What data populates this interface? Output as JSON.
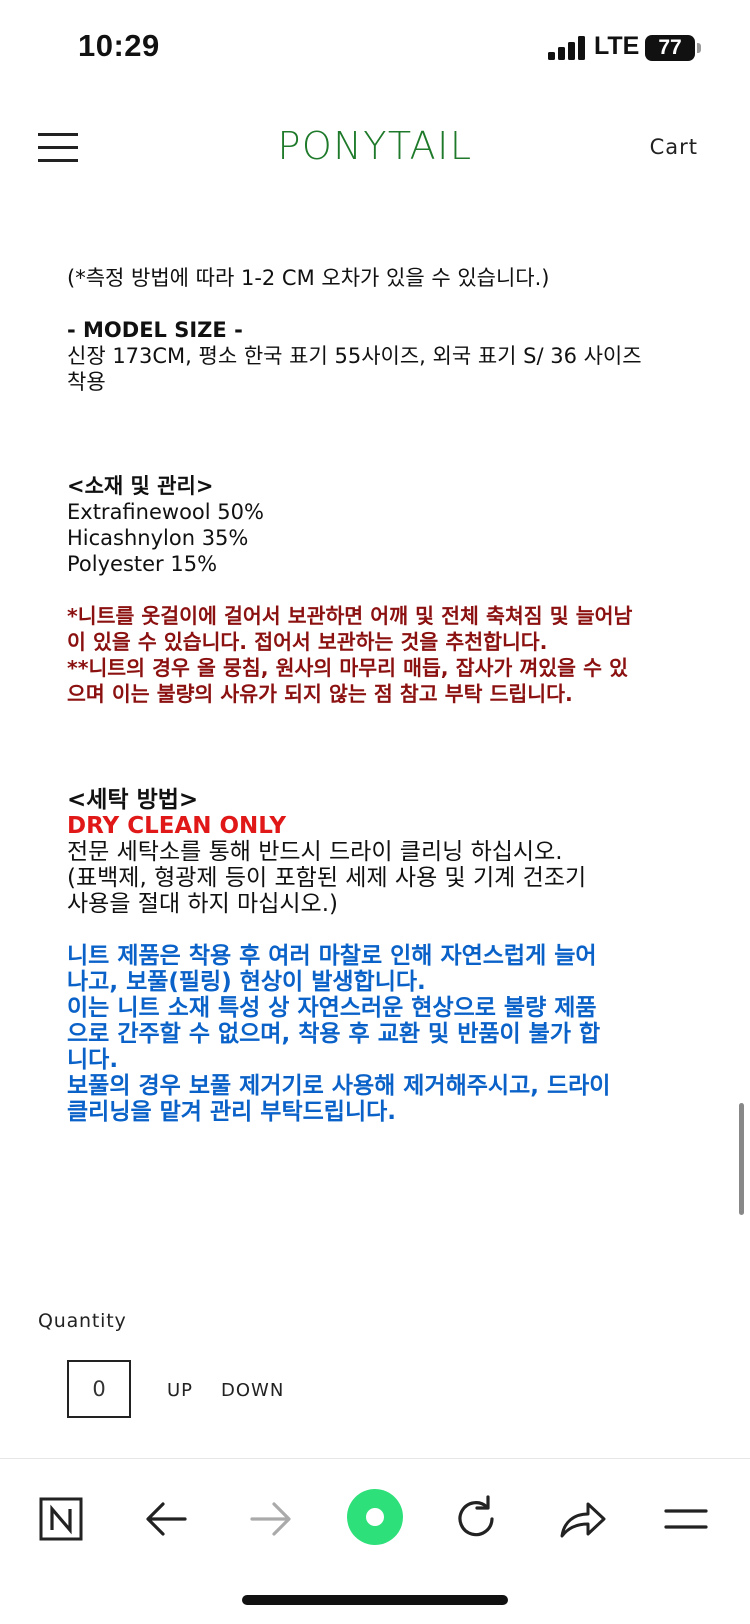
{
  "status": {
    "time": "10:29",
    "network": "LTE",
    "battery": "77"
  },
  "header": {
    "brand": "PONYTAIL",
    "cart": "Cart"
  },
  "content": {
    "measure_note": "(*측정 방법에 따라 1-2 CM 오차가 있을 수 있습니다.)",
    "model_title": "- MODEL SIZE -",
    "model_line1": "신장 173CM, 평소 한국 표기 55사이즈, 외국 표기 S/ 36 사이즈",
    "model_line2": "착용",
    "material_title": "<소재 및 관리>",
    "material1": "Extrafinewool 50%",
    "material2": "Hicashnylon 35%",
    "material3": "Polyester 15%",
    "care_red1": "*니트를 옷걸이에 걸어서 보관하면 어깨 및 전체 축쳐짐 및 늘어남",
    "care_red2": "이 있을 수 있습니다. 접어서 보관하는 것을 추천합니다.",
    "care_red3": "**니트의 경우 올 뭉침, 원사의 마무리 매듭, 잡사가 껴있을 수 있",
    "care_red4": "으며 이는 불량의 사유가 되지 않는 점 참고 부탁 드립니다.",
    "wash_title": "<세탁 방법>",
    "dry_clean": "DRY CLEAN ONLY",
    "wash1": "전문 세탁소를 통해 반드시 드라이 클리닝 하십시오.",
    "wash2": "(표백제, 형광제 등이 포함된 세제 사용 및 기계 건조기",
    "wash3": "사용을 절대 하지 마십시오.)",
    "blue1": "니트 제품은 착용 후 여러 마찰로 인해 자연스럽게 늘어",
    "blue2": "나고, 보풀(필링) 현상이 발생합니다.",
    "blue3": "이는 니트 소재 특성 상 자연스러운 현상으로 불량 제품",
    "blue4": "으로 간주할 수 없으며, 착용 후 교환 및 반품이 불가 합",
    "blue5": "니다.",
    "blue6": "보풀의 경우 보풀 제거기로 사용해 제거해주시고, 드라이",
    "blue7": "클리닝을 맡겨 관리 부탁드립니다."
  },
  "quantity": {
    "label": "Quantity",
    "value": "0",
    "up": "UP",
    "down": "DOWN"
  },
  "bottom_nav": {
    "icons": [
      "naver-n-icon",
      "back-arrow-icon",
      "forward-arrow-icon",
      "green-dot-icon",
      "reload-icon",
      "share-icon",
      "menu-icon"
    ],
    "accent_color": "#2ee07a"
  }
}
